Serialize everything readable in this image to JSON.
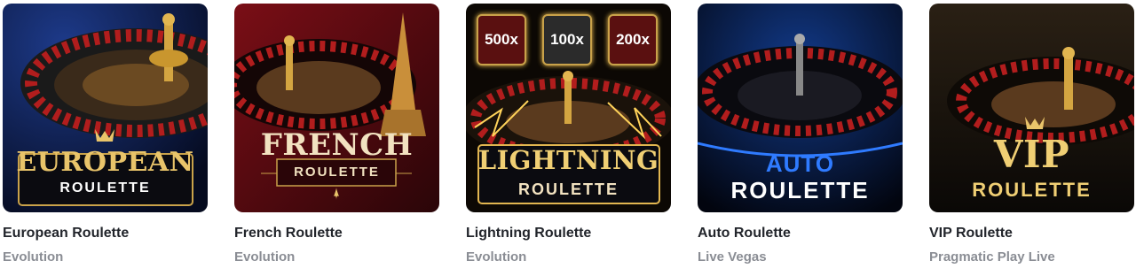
{
  "games": [
    {
      "title": "European Roulette",
      "provider": "Evolution",
      "logo_line1": "EUROPEAN",
      "logo_line2": "ROULETTE",
      "icon": "crown-icon"
    },
    {
      "title": "French Roulette",
      "provider": "Evolution",
      "logo_line1": "FRENCH",
      "logo_line2": "ROULETTE",
      "icon": "fleur-de-lis-icon"
    },
    {
      "title": "Lightning Roulette",
      "provider": "Evolution",
      "logo_line1": "LIGHTNING",
      "logo_line2": "ROULETTE",
      "multipliers": [
        "500x",
        "100x",
        "200x"
      ]
    },
    {
      "title": "Auto Roulette",
      "provider": "Live Vegas",
      "logo_line1": "AUTO",
      "logo_line2": "ROULETTE"
    },
    {
      "title": "VIP Roulette",
      "provider": "Pragmatic Play Live",
      "logo_line1": "VIP",
      "logo_line2": "ROULETTE",
      "icon": "crown-icon"
    }
  ],
  "colors": {
    "gold": "#e9c46a",
    "title": "#22252b",
    "provider": "#8a8d94",
    "auto_blue": "#2f7bff"
  }
}
